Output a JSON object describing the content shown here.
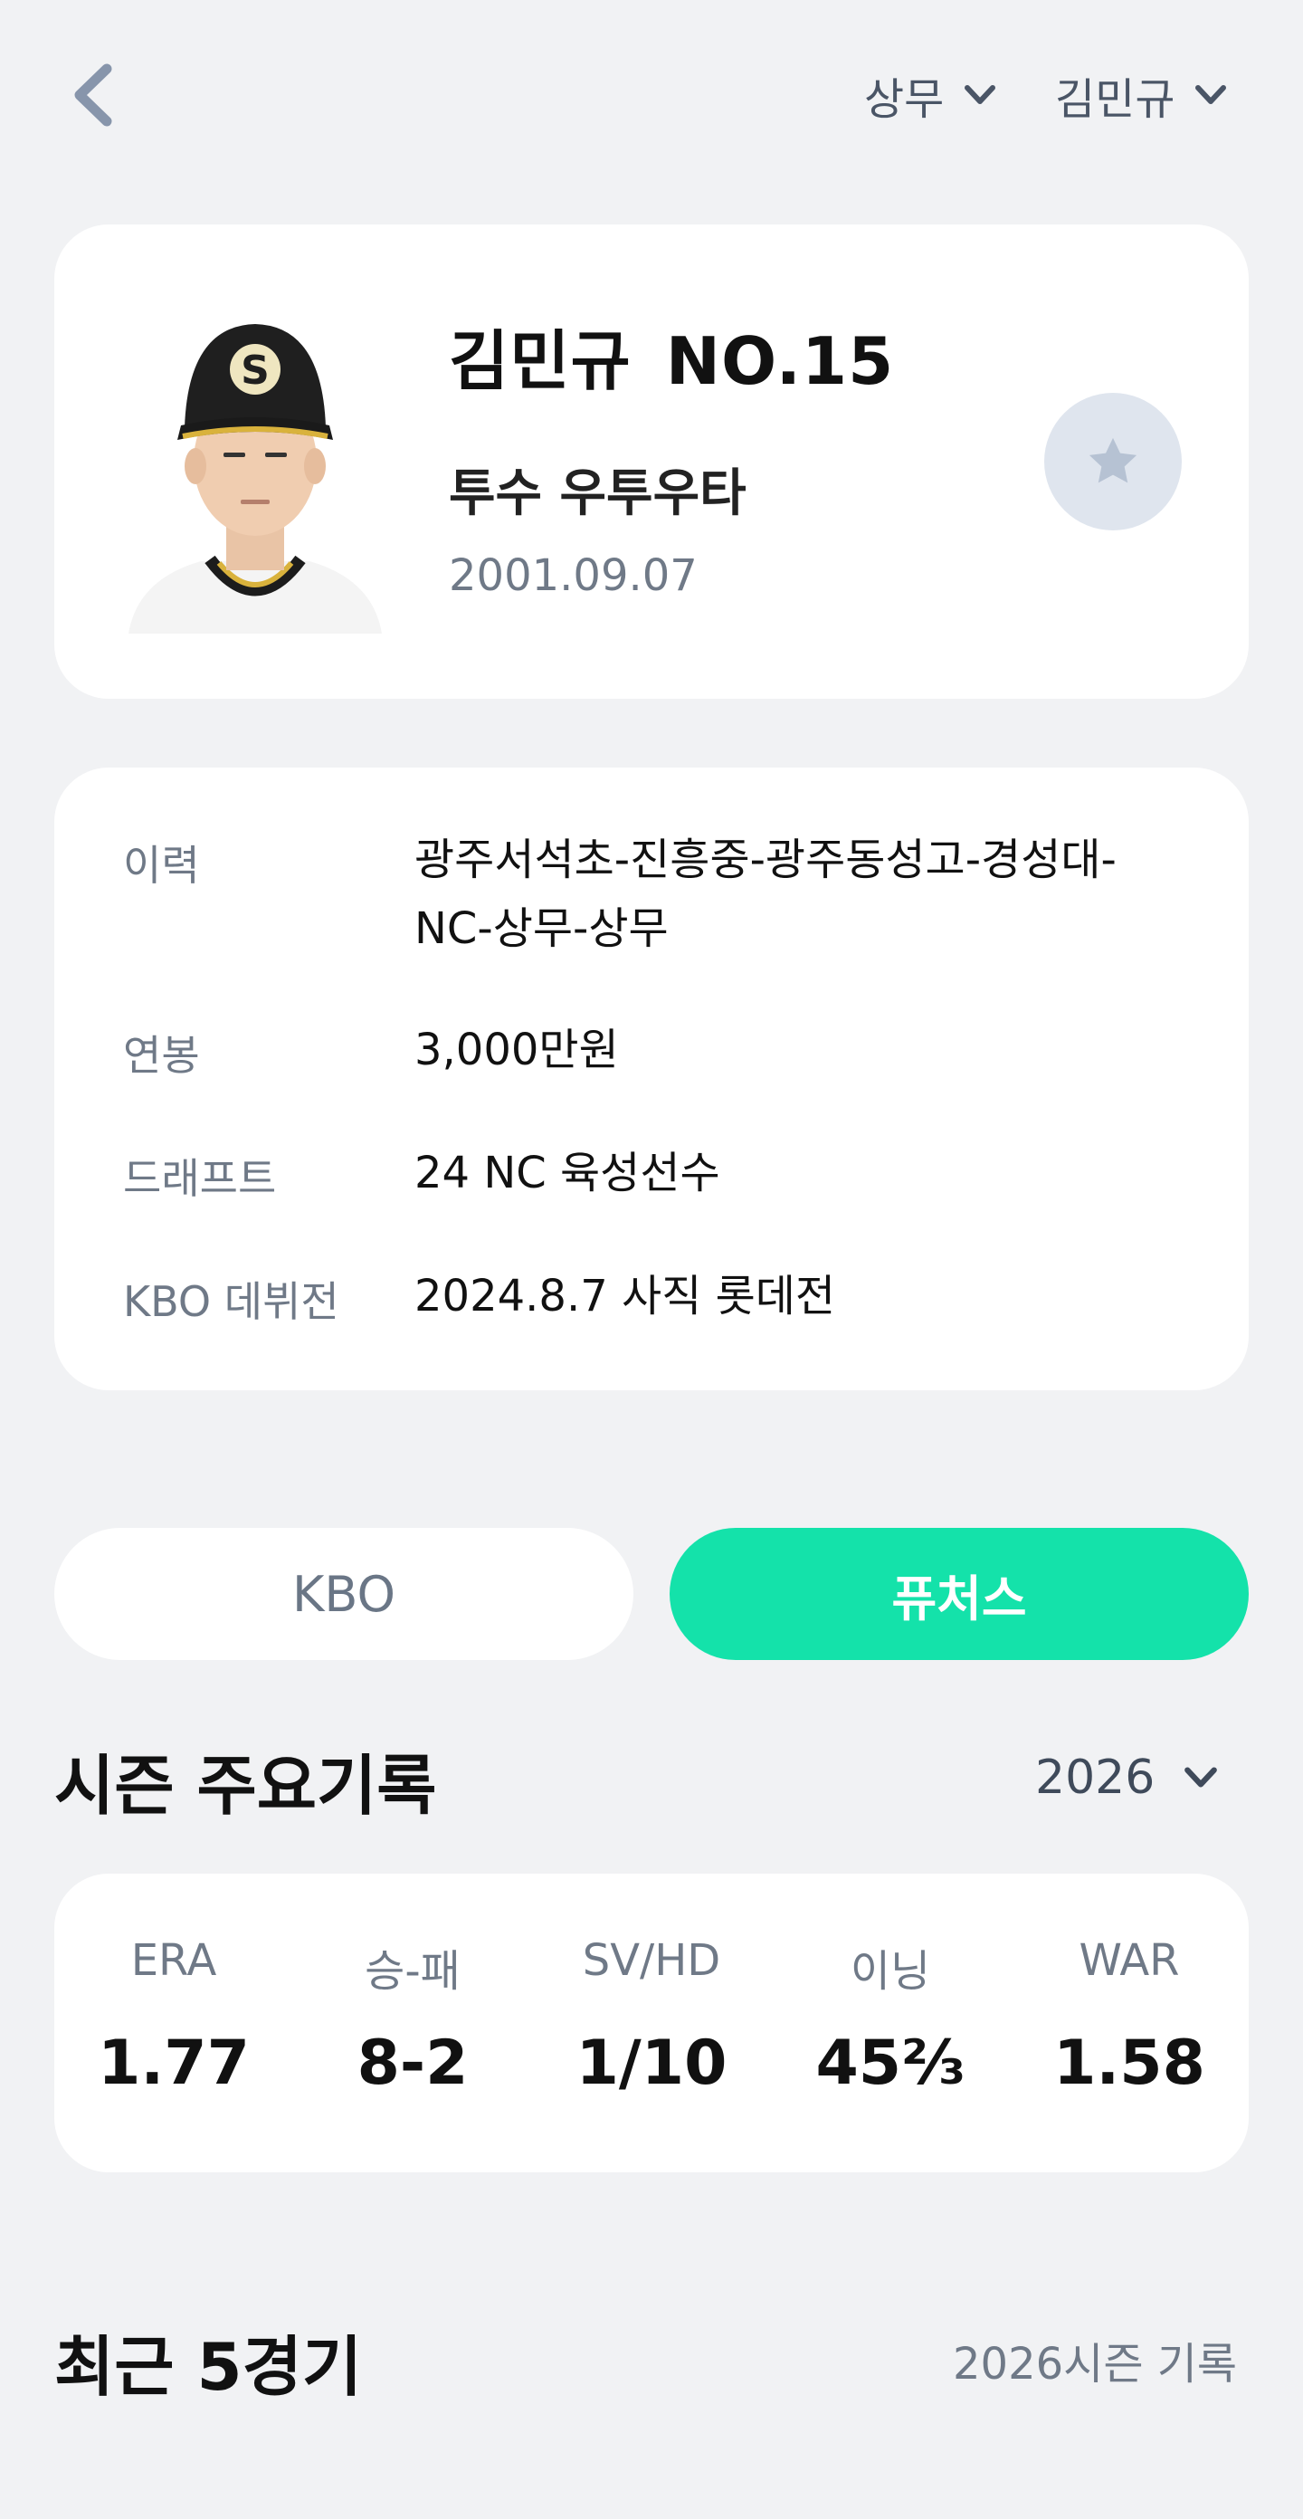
{
  "header": {
    "back_icon": "chevron-left-icon",
    "team_dropdown": "상무",
    "player_dropdown": "김민규"
  },
  "profile": {
    "name": "김민규",
    "number": "NO.15",
    "position": "투수 우투우타",
    "birthdate": "2001.09.07",
    "favorite_icon": "star-icon",
    "photo_cap_letter": "S"
  },
  "info": {
    "rows": [
      {
        "label": "이력",
        "value": "광주서석초-진흥중-광주동성고-경성대-NC-상무-상무"
      },
      {
        "label": "연봉",
        "value": "3,000만원"
      },
      {
        "label": "드래프트",
        "value": "24 NC 육성선수"
      },
      {
        "label": "KBO 데뷔전",
        "value": "2024.8.7 사직 롯데전"
      }
    ]
  },
  "tabs": {
    "kbo": "KBO",
    "futures": "퓨처스",
    "selected": "퓨처스"
  },
  "season": {
    "title": "시즌 주요기록",
    "year": "2026",
    "stats": [
      {
        "label": "ERA",
        "value": "1.77"
      },
      {
        "label": "승-패",
        "value": "8-2"
      },
      {
        "label": "SV/HD",
        "value": "1/10"
      },
      {
        "label": "이닝",
        "value": "45⅔"
      },
      {
        "label": "WAR",
        "value": "1.58"
      }
    ]
  },
  "recent": {
    "title": "최근 5경기",
    "subtitle": "2026시즌 기록"
  },
  "colors": {
    "background": "#f1f2f4",
    "accent": "#14e2aa",
    "muted_text": "#6f7987",
    "favorite_bg": "#dfe5ee"
  }
}
